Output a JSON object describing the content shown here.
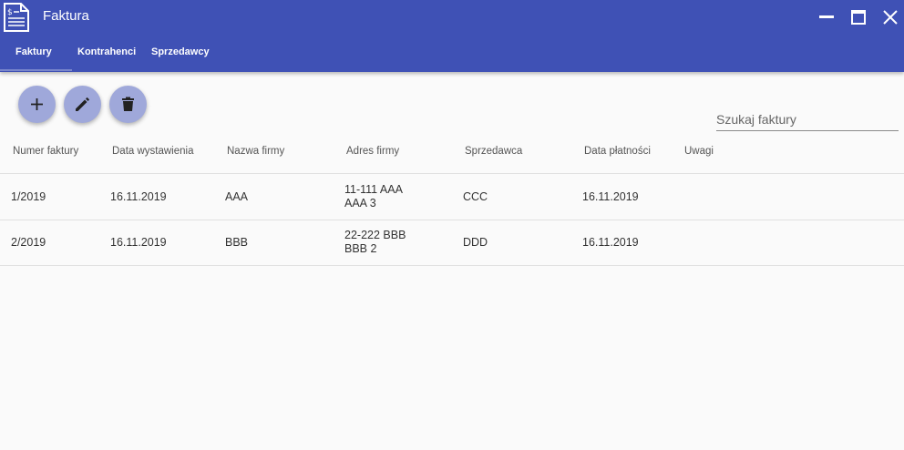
{
  "app": {
    "title": "Faktura",
    "brand_color": "#3f51b5",
    "icon": "invoice-document-icon"
  },
  "window_controls": [
    "minimize-icon",
    "maximize-icon",
    "close-icon"
  ],
  "tabs": [
    {
      "label": "Faktury",
      "active": true
    },
    {
      "label": "Kontrahenci",
      "active": false
    },
    {
      "label": "Sprzedawcy",
      "active": false
    }
  ],
  "toolbar": {
    "add_icon": "plus-icon",
    "edit_icon": "pencil-icon",
    "delete_icon": "trash-icon",
    "fab_color": "#9fa8da"
  },
  "search": {
    "placeholder": "Szukaj faktury",
    "value": ""
  },
  "table": {
    "columns": [
      "Numer faktury",
      "Data wystawienia",
      "Nazwa firmy",
      "Adres firmy",
      "Sprzedawca",
      "Data płatności",
      "Uwagi"
    ],
    "rows": [
      {
        "numer": "1/2019",
        "data_wystawienia": "16.11.2019",
        "nazwa": "AAA",
        "adres_1": "11-111 AAA",
        "adres_2": "AAA 3",
        "sprzedawca": "CCC",
        "data_platnosci": "16.11.2019",
        "uwagi": ""
      },
      {
        "numer": "2/2019",
        "data_wystawienia": "16.11.2019",
        "nazwa": "BBB",
        "adres_1": "22-222 BBB",
        "adres_2": "BBB 2",
        "sprzedawca": "DDD",
        "data_platnosci": "16.11.2019",
        "uwagi": ""
      }
    ]
  }
}
